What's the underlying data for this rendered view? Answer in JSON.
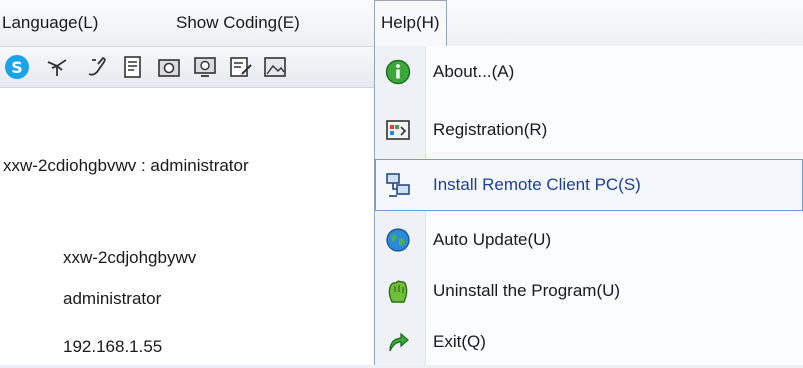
{
  "menubar": {
    "language": "Language(L)",
    "show_coding": "Show Coding(E)",
    "help": "Help(H)"
  },
  "toolbar": {
    "icons": [
      "skype-icon",
      "antenna-icon",
      "wand-icon",
      "document-icon",
      "camera-icon",
      "monitor-icon",
      "edit-document-icon",
      "image-icon"
    ]
  },
  "content": {
    "session_label": "xxw-2cdiohgbvwv : administrator",
    "computer_name": "xxw-2cdjohgbywv",
    "user_name": "administrator",
    "ip_address": "192.168.1.55"
  },
  "help_menu": {
    "items": [
      {
        "label": "About...(A)",
        "icon": "info-icon",
        "highlighted": false
      },
      {
        "label": "Registration(R)",
        "icon": "registration-icon",
        "highlighted": false
      },
      {
        "label": "Install Remote Client PC(S)",
        "icon": "network-pc-icon",
        "highlighted": true
      },
      {
        "label": "Auto Update(U)",
        "icon": "globe-update-icon",
        "highlighted": false
      },
      {
        "label": "Uninstall the Program(U)",
        "icon": "uninstall-icon",
        "highlighted": false
      },
      {
        "label": "Exit(Q)",
        "icon": "exit-arrow-icon",
        "highlighted": false
      }
    ]
  },
  "colors": {
    "highlight_border": "#6d9fd6",
    "highlight_text": "#1f3f8f"
  }
}
